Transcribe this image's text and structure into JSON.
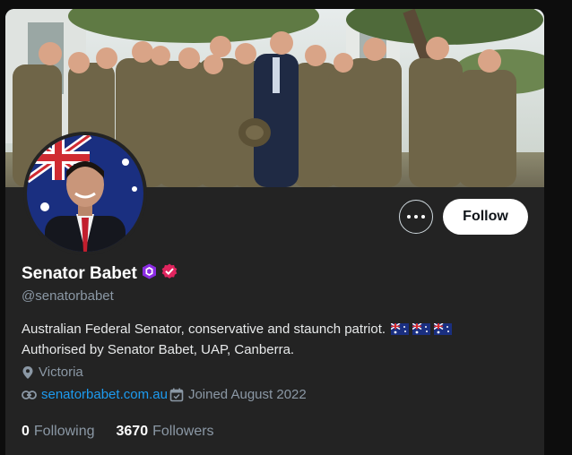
{
  "profile": {
    "display_name": "Senator Babet",
    "handle": "@senatorbabet",
    "bio_line1": "Australian Federal Senator, conservative and staunch patriot.",
    "bio_line2": "Authorised by Senator Babet, UAP, Canberra.",
    "location": "Victoria",
    "website": "senatorbabet.com.au",
    "joined": "Joined August 2022",
    "following_count": "0",
    "following_label": "Following",
    "followers_count": "3670",
    "followers_label": "Followers"
  },
  "actions": {
    "follow_label": "Follow"
  },
  "icons": {
    "more": "more-options-icon",
    "badge_1": "hexagon-verified-icon",
    "badge_2": "red-verified-icon",
    "location": "location-pin-icon",
    "link": "link-icon",
    "calendar": "calendar-icon",
    "bio_flags": "australian-flag-icon"
  },
  "colors": {
    "background": "#232323",
    "link": "#1d9bf0",
    "follow_button": "#ffffff",
    "badge_purple": "#8a2be2",
    "badge_red": "#e0245e"
  }
}
